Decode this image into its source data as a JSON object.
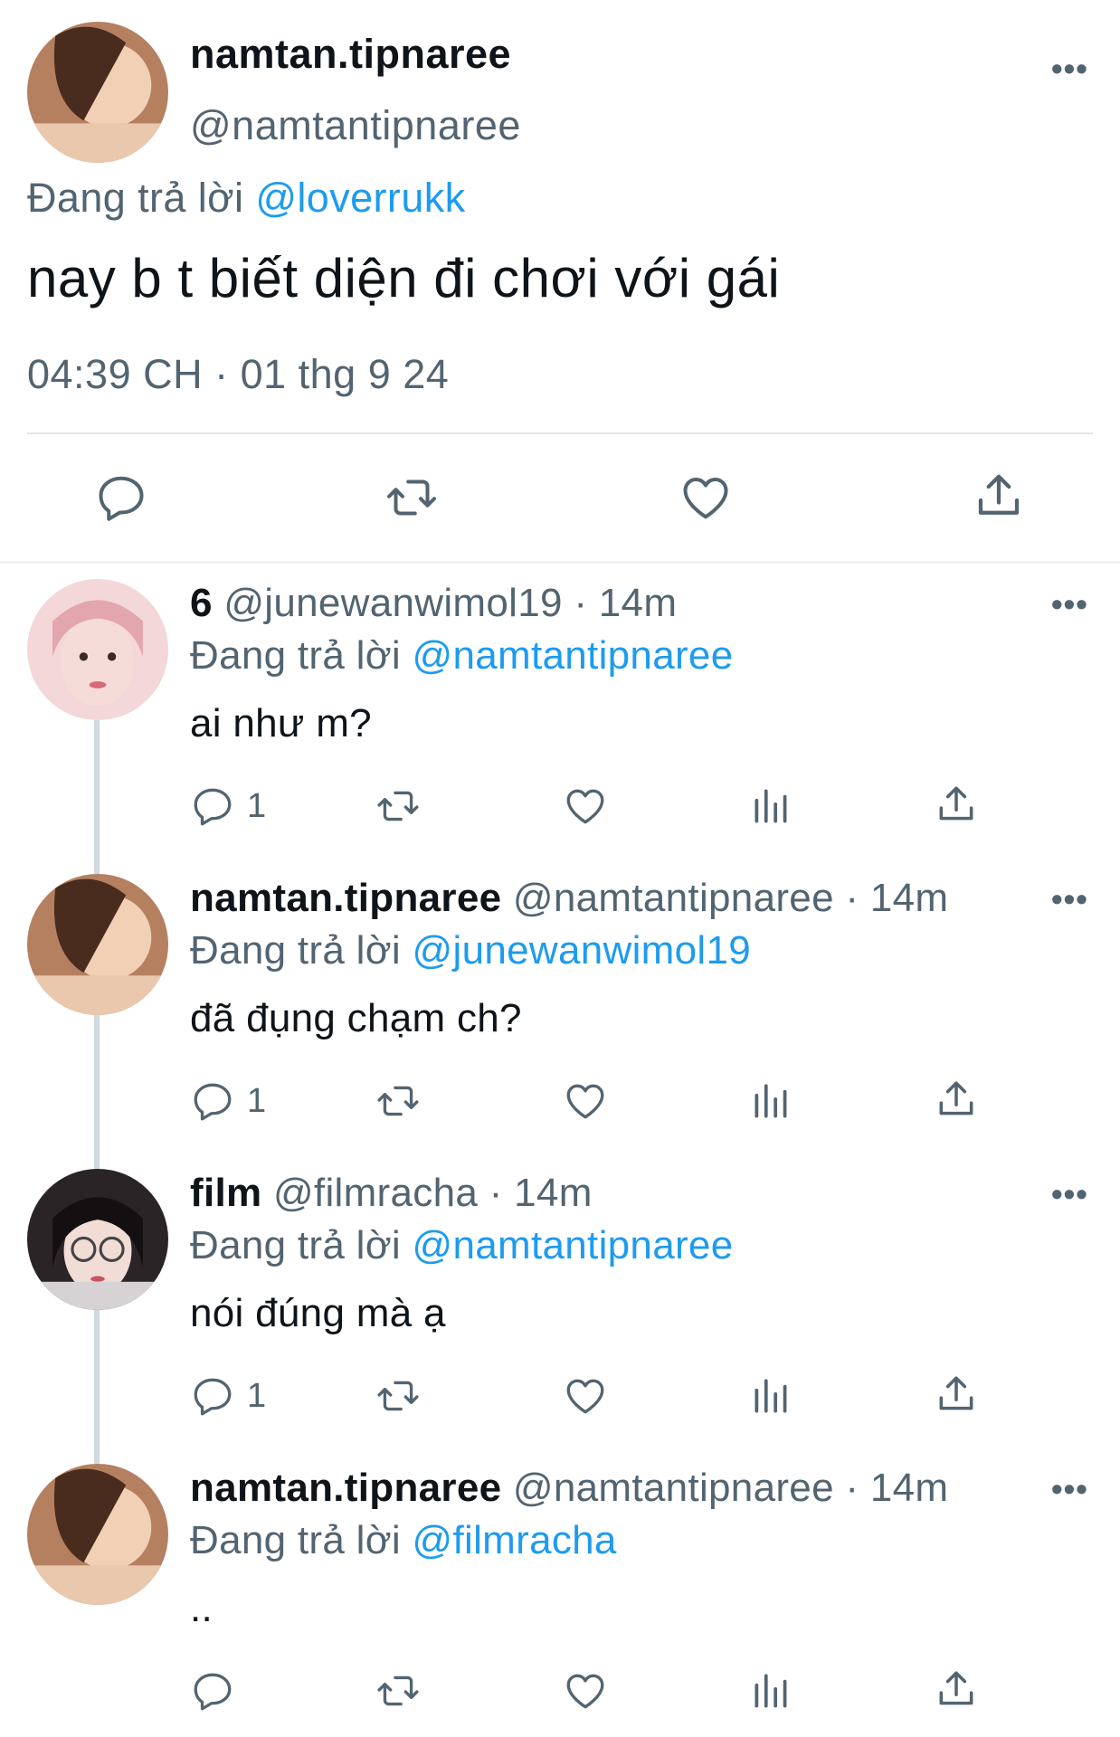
{
  "main_tweet": {
    "display_name": "namtan.tipnaree",
    "handle": "@namtantipnaree",
    "reply_prefix": "Đang trả lời",
    "reply_to": "@loverrukk",
    "text": "nay b t biết diện đi chơi với gái",
    "timestamp": "04:39 CH · 01 thg 9 24",
    "more_icon": "ellipsis-icon",
    "actions": [
      "reply-icon",
      "retweet-icon",
      "like-icon",
      "share-icon"
    ]
  },
  "replies": [
    {
      "display_name": "6",
      "handle": "@junewanwimol19",
      "time": "· 14m",
      "reply_prefix": "Đang trả lời",
      "reply_to": "@namtantipnaree",
      "text": "ai như m?",
      "reply_count": "1"
    },
    {
      "display_name": "namtan.tipnaree",
      "handle": "@namtantipnaree",
      "time": "· 14m",
      "reply_prefix": "Đang trả lời",
      "reply_to": "@junewanwimol19",
      "text": "đã đụng chạm ch?",
      "reply_count": "1"
    },
    {
      "display_name": "film",
      "handle": "@filmracha",
      "time": "· 14m",
      "reply_prefix": "Đang trả lời",
      "reply_to": "@namtantipnaree",
      "text": "nói đúng mà ạ",
      "reply_count": "1"
    },
    {
      "display_name": "namtan.tipnaree",
      "handle": "@namtantipnaree",
      "time": "· 14m",
      "reply_prefix": "Đang trả lời",
      "reply_to": "@filmracha",
      "text": "..",
      "reply_count": ""
    }
  ],
  "more_label": "•••",
  "colors": {
    "link": "#1d9bf0",
    "muted": "#536471",
    "text": "#0f1419",
    "thread_line": "#cfd9de"
  }
}
